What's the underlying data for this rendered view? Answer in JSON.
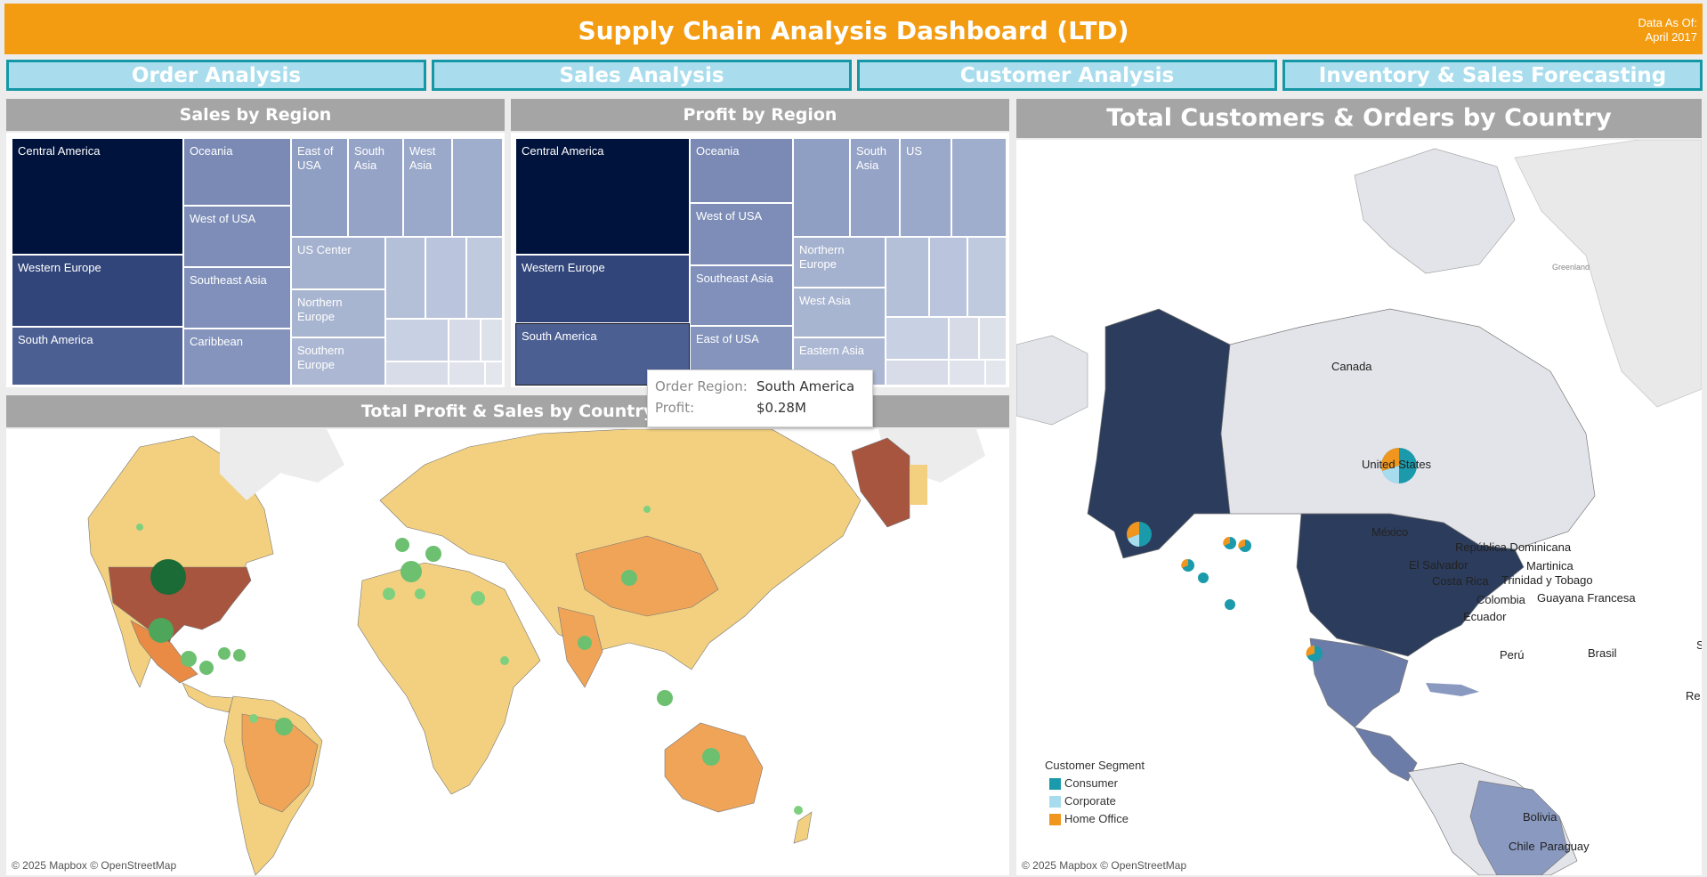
{
  "header": {
    "title": "Supply Chain Analysis Dashboard (LTD)",
    "as_of_label": "Data As Of:",
    "as_of_value": "April 2017"
  },
  "nav": [
    {
      "label": "Order Analysis"
    },
    {
      "label": "Sales Analysis"
    },
    {
      "label": "Customer Analysis"
    },
    {
      "label": "Inventory & Sales Forecasting"
    }
  ],
  "sales_by_region": {
    "title": "Sales by Region",
    "labels": [
      "Central America",
      "Western Europe",
      "South America",
      "Oceania",
      "West of USA",
      "Southeast Asia",
      "Caribbean",
      "East of USA",
      "South Asia",
      "West Asia",
      "US Center",
      "Northern Europe",
      "Southern Europe"
    ]
  },
  "profit_by_region": {
    "title": "Profit by Region",
    "labels": [
      "Central America",
      "Western Europe",
      "South America",
      "Oceania",
      "West of USA",
      "Southeast Asia",
      "East of USA",
      "South Asia",
      "US",
      "Northern Europe",
      "West Asia",
      "Eastern Asia"
    ]
  },
  "tooltip": {
    "k1": "Order Region:",
    "v1": "South America",
    "k2": "Profit:",
    "v2": "$0.28M"
  },
  "profit_sales_map": {
    "title": "Total Profit & Sales by Country",
    "credit": "© 2025 Mapbox © OpenStreetMap"
  },
  "customers_map": {
    "title": "Total Customers & Orders by Country",
    "credit": "© 2025 Mapbox © OpenStreetMap",
    "labels": {
      "greenland": "Greenland",
      "canada": "Canada",
      "us": "United States",
      "mexico": "México",
      "rep_dom": "República Dominicana",
      "martinica": "Martinica",
      "el_salvador": "El Salvador",
      "trinidad": "Trinidad y Tobago",
      "costa_rica": "Costa Rica",
      "colombia": "Colombia",
      "guayana": "Guayana Francesa",
      "ecuador": "Ecuador",
      "peru": "Perú",
      "brasil": "Brasil",
      "bolivia": "Bolivia",
      "chile": "Chile",
      "paraguay": "Paraguay",
      "edge_s": "S",
      "edge_re": "Re"
    },
    "legend": {
      "title": "Customer Segment",
      "items": [
        {
          "label": "Consumer",
          "color": "#1a9aab"
        },
        {
          "label": "Corporate",
          "color": "#a7dcee"
        },
        {
          "label": "Home Office",
          "color": "#f0951e"
        }
      ]
    }
  },
  "colors": {
    "accent": "#f39c12",
    "nav_border": "#1597a5",
    "nav_fill": "#a9dded",
    "tree_darkest": "#00133d",
    "map_highlight": "#a8553f"
  }
}
